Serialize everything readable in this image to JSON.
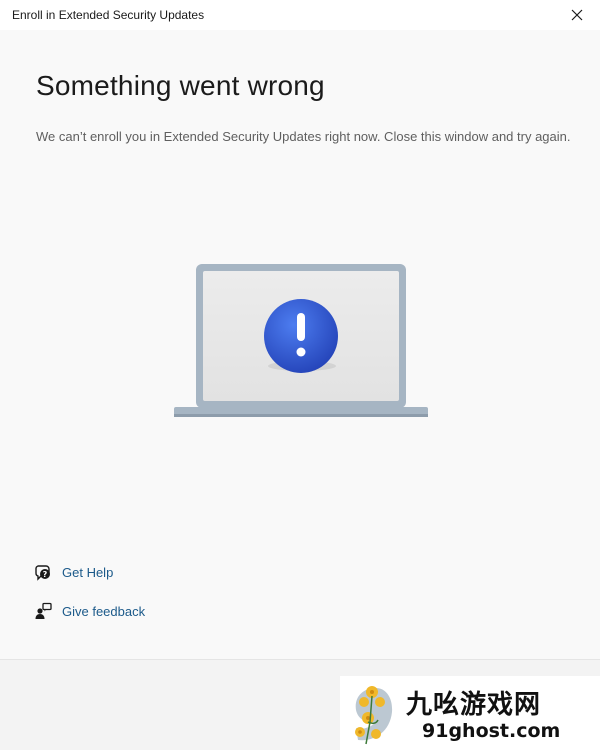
{
  "window": {
    "title": "Enroll in Extended Security Updates",
    "close_icon": "close-icon"
  },
  "main": {
    "heading": "Something went wrong",
    "message": "We can’t enroll you in Extended Security Updates right now. Close this window and try again.",
    "illustration": "laptop-error-illustration",
    "error_symbol": "!"
  },
  "links": {
    "get_help": {
      "label": "Get Help",
      "icon": "help-chat-icon"
    },
    "give_feedback": {
      "label": "Give feedback",
      "icon": "feedback-icon"
    }
  },
  "watermark": {
    "brand": "九吆游戏网",
    "url": "91ghost.com"
  },
  "colors": {
    "accent_blue": "#2f54c8",
    "link": "#1c5a8a",
    "background": "#f9f9f9"
  }
}
